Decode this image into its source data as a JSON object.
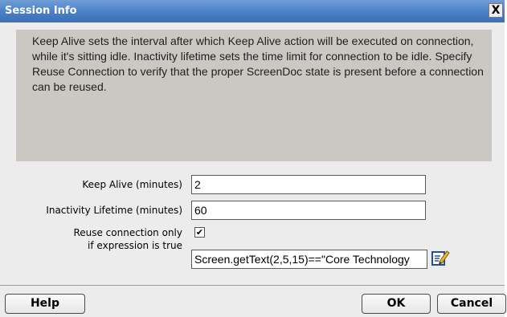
{
  "dialog": {
    "title": "Session Info",
    "close_glyph": "X",
    "description": "Keep Alive sets the interval after which Keep Alive action will be executed on connection, while it's sitting idle. Inactivity lifetime sets the time limit for connection to be idle. Specify Reuse Connection to verify that the proper ScreenDoc state is present before a connection can be reused."
  },
  "form": {
    "keep_alive_label": "Keep Alive (minutes)",
    "keep_alive_value": "2",
    "inactivity_label": "Inactivity Lifetime (minutes)",
    "inactivity_value": "60",
    "reuse_label_line1": "Reuse connection only",
    "reuse_label_line2": "if expression is true",
    "reuse_checked": true,
    "reuse_check_glyph": "✔",
    "expression_value": "Screen.getText(2,5,15)==\"Core Technology"
  },
  "buttons": {
    "help": "Help",
    "ok": "OK",
    "cancel": "Cancel"
  },
  "icons": {
    "close": "close-icon",
    "edit_expression": "edit-icon"
  },
  "colors": {
    "titlebar": "#4a7fc4",
    "panel": "#cbc8c3",
    "window": "#ececec"
  }
}
